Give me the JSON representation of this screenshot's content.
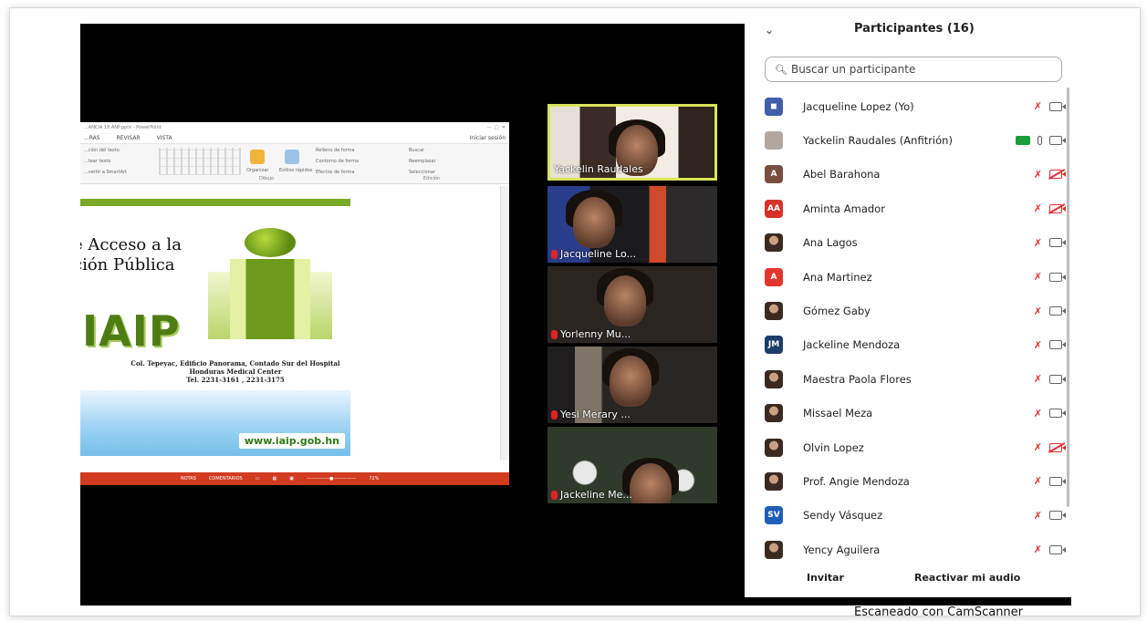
{
  "shared_screen": {
    "title_bar": "...ANCIA 18 ANP.pptx - PowerPoint",
    "title_bar_right": "Iniciar sesión",
    "ribbon_tabs": [
      "...RAS",
      "REVISAR",
      "VISTA"
    ],
    "ribbon_right": "Iniciar sesión",
    "ribbon_groups": {
      "dibujo": "Dibujo",
      "edicion": "Edición"
    },
    "ribbon_buttons": {
      "organizar": "Organizar",
      "estilos_rapidos": "Estilos rápidos",
      "relleno": "Relleno de forma",
      "contorno": "Contorno de forma",
      "efectos": "Efectos de forma",
      "buscar": "Buscar",
      "reemplazar": "Reemplazar",
      "seleccionar": "Seleccionar"
    },
    "ribbon_left": [
      "...ción del texto",
      "...tear texto",
      "...vertir a SmartArt"
    ],
    "slide": {
      "title": "e Acceso a la\nción Pública",
      "logo_text": "IAIP",
      "address": "Col. Tepeyac, Edificio Panorama, Contado Sur del Hospital Honduras Medical Center\nTel. 2231-3161 , 2231-3175",
      "url": "www.iaip.gob.hn"
    },
    "status_bar": [
      "NOTAS",
      "COMENTARIOS",
      "72%"
    ]
  },
  "video_tiles": [
    {
      "name": "Yackelin Raudales",
      "active": true,
      "muted": false
    },
    {
      "name": "Jacqueline Lo...",
      "active": false,
      "muted": true
    },
    {
      "name": "Yorlenny Mu...",
      "active": false,
      "muted": true
    },
    {
      "name": "Yesi Merary ...",
      "active": false,
      "muted": true
    },
    {
      "name": "Jackeline Me...",
      "active": false,
      "muted": true
    }
  ],
  "participants_panel": {
    "title": "Participantes (16)",
    "search_placeholder": "Buscar un participante",
    "participants": [
      {
        "name": "Jacqueline Lopez (Yo)",
        "avatar": "logo",
        "avatar_color": "#3f5fa8",
        "mic": "off",
        "video": "on"
      },
      {
        "name": "Yackelin Raudales (Anfitrión)",
        "avatar": "plain",
        "avatar_color": "#b2a79f",
        "mic": "on",
        "video": "on",
        "host_badge": true
      },
      {
        "name": "Abel Barahona",
        "avatar": "A",
        "avatar_color": "#7a4e3d",
        "mic": "off",
        "video": "off"
      },
      {
        "name": "Aminta Amador",
        "avatar": "AA",
        "avatar_color": "#d7322a",
        "mic": "off",
        "video": "off"
      },
      {
        "name": "Ana Lagos",
        "avatar": "photo",
        "avatar_color": "#5e4033",
        "mic": "off",
        "video": "on"
      },
      {
        "name": "Ana Martinez",
        "avatar": "A",
        "avatar_color": "#e0362f",
        "mic": "off",
        "video": "on"
      },
      {
        "name": "Gómez Gaby",
        "avatar": "photo",
        "avatar_color": "#6b3d2a",
        "mic": "off",
        "video": "on"
      },
      {
        "name": "Jackeline Mendoza",
        "avatar": "JM",
        "avatar_color": "#1c3d69",
        "mic": "off",
        "video": "on"
      },
      {
        "name": "Maestra Paola Flores",
        "avatar": "photo",
        "avatar_color": "#a77a4c",
        "mic": "off",
        "video": "on"
      },
      {
        "name": "Missael Meza",
        "avatar": "photo",
        "avatar_color": "#2f6b5b",
        "mic": "off",
        "video": "on"
      },
      {
        "name": "Olvin Lopez",
        "avatar": "photo",
        "avatar_color": "#3b3150",
        "mic": "off",
        "video": "off"
      },
      {
        "name": "Prof. Angie Mendoza",
        "avatar": "photo",
        "avatar_color": "#4d352b",
        "mic": "off",
        "video": "on"
      },
      {
        "name": "Sendy Vásquez",
        "avatar": "SV",
        "avatar_color": "#1f5fb8",
        "mic": "off",
        "video": "on"
      },
      {
        "name": "Yency Aguilera",
        "avatar": "photo",
        "avatar_color": "#6b4a36",
        "mic": "off",
        "video": "on"
      }
    ],
    "invite_label": "Invitar",
    "unmute_label": "Reactivar mi audio"
  },
  "scanner_watermark": "Escaneado con CamScanner"
}
